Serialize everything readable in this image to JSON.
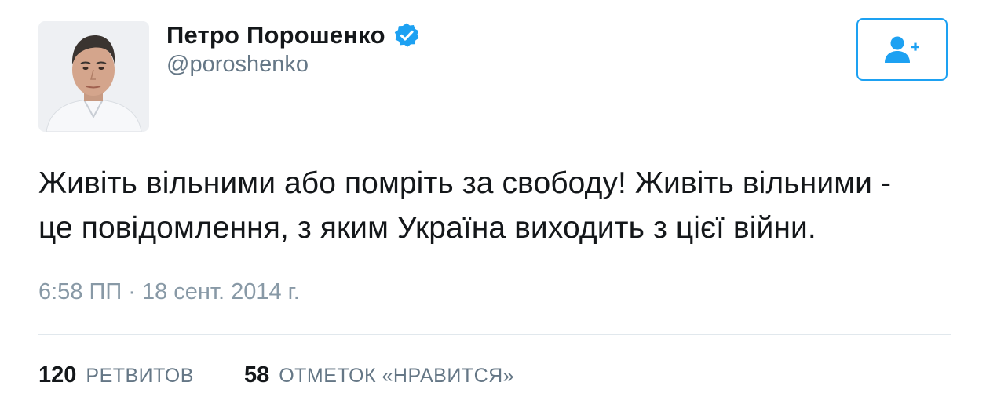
{
  "user": {
    "display_name": "Петро Порошенко",
    "handle": "@poroshenko",
    "verified": true,
    "verified_icon": "verified-badge-icon"
  },
  "follow_button": {
    "icon": "add-user-icon"
  },
  "tweet": {
    "text": "Живіть вільними або помріть за свободу! Живіть вільними -\nце повідомлення, з яким Україна виходить з цієї війни.",
    "timestamp": "6:58 ПП · 18 сент. 2014 г."
  },
  "stats": {
    "retweets_count": "120",
    "retweets_label": "РЕТВИТОВ",
    "likes_count": "58",
    "likes_label": "ОТМЕТОК «НРАВИТСЯ»"
  },
  "colors": {
    "accent": "#1da1f2",
    "text": "#14171a",
    "secondary": "#657786",
    "timestamp": "#8899a6",
    "divider": "#e1e8ed"
  }
}
